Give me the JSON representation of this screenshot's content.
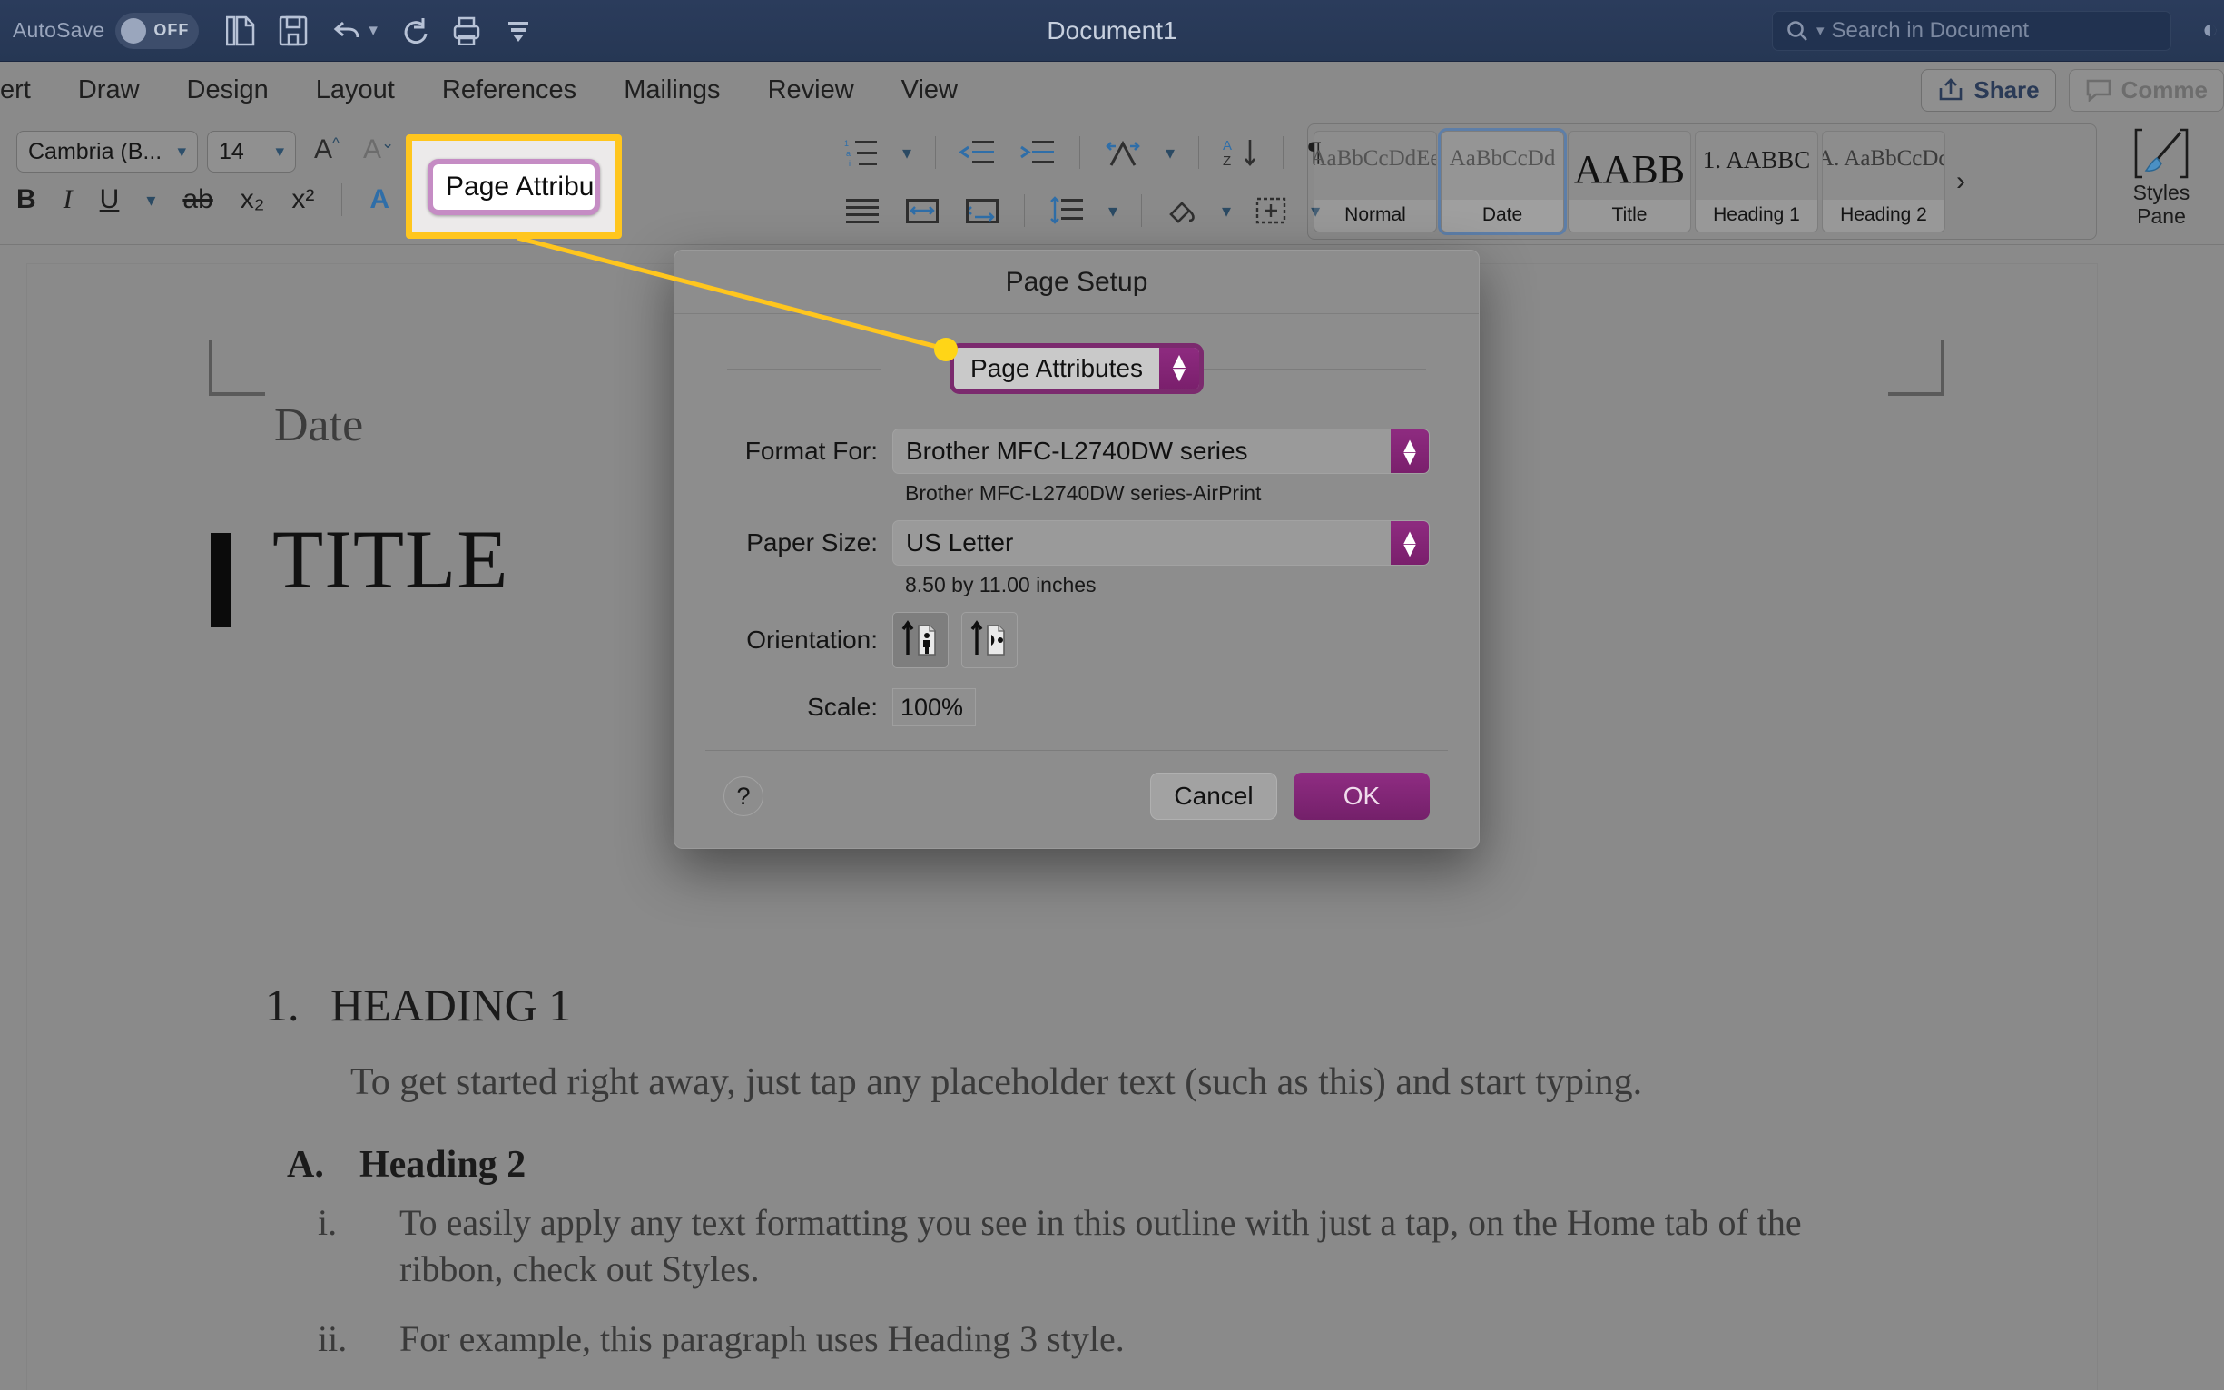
{
  "titlebar": {
    "autosave_label": "AutoSave",
    "autosave_state": "OFF",
    "document_title": "Document1",
    "search_placeholder": "Search in Document",
    "quick_access": [
      {
        "name": "new-from-template-icon",
        "label": "New"
      },
      {
        "name": "save-icon",
        "label": "Save"
      },
      {
        "name": "undo-icon",
        "label": "Undo"
      },
      {
        "name": "redo-icon",
        "label": "Redo"
      },
      {
        "name": "print-icon",
        "label": "Print"
      },
      {
        "name": "customize-toolbar-icon",
        "label": "Customize"
      }
    ]
  },
  "ribbon": {
    "tabs": [
      "ert",
      "Draw",
      "Design",
      "Layout",
      "References",
      "Mailings",
      "Review",
      "View"
    ],
    "share_label": "Share",
    "comments_label": "Comme",
    "font_name": "Cambria (B...",
    "font_size": "14",
    "grow_font": "A",
    "shrink_font": "A",
    "format_icons": [
      "B",
      "I",
      "U",
      "ab",
      "x₂",
      "x²",
      "A"
    ],
    "styles": [
      {
        "preview": "AaBbCcDdEe",
        "name": "Normal",
        "selected": false
      },
      {
        "preview": "AaBbCcDd",
        "name": "Date",
        "selected": true
      },
      {
        "preview": "AABB",
        "name": "Title",
        "selected": false
      },
      {
        "preview": "1.  AABBC",
        "name": "Heading 1",
        "selected": false
      },
      {
        "preview": "A. AaBbCcDd",
        "name": "Heading 2",
        "selected": false
      }
    ],
    "gallery_more": "›",
    "styles_pane_label_line1": "Styles",
    "styles_pane_label_line2": "Pane"
  },
  "callout": {
    "value": "Page Attributes",
    "highlight_color": "#FFC61E",
    "select_border_color": "#c58cc4",
    "stepper_color": "#b4309f"
  },
  "dialog": {
    "title": "Page Setup",
    "attributes_value": "Page Attributes",
    "format_for_label": "Format For:",
    "format_for_value": "Brother MFC-L2740DW series",
    "format_for_note": "Brother MFC-L2740DW series-AirPrint",
    "paper_size_label": "Paper Size:",
    "paper_size_value": "US Letter",
    "paper_size_note": "8.50 by 11.00 inches",
    "orientation_label": "Orientation:",
    "orientation_selected": "portrait",
    "scale_label": "Scale:",
    "scale_value": "100%",
    "help_label": "?",
    "cancel_label": "Cancel",
    "ok_label": "OK",
    "accent_color": "#7a1f6c"
  },
  "document": {
    "date": "Date",
    "title": "TITLE",
    "heading1_number": "1.",
    "heading1_text": "HEADING 1",
    "paragraph1": "To get started right away, just tap any placeholder text (such as this) and start typing.",
    "heading2_number": "A.",
    "heading2_text": "Heading 2",
    "list_items": [
      {
        "marker": "i.",
        "text": "To easily apply any text formatting you see in this outline with just a tap, on the Home tab of the ribbon, check out Styles."
      },
      {
        "marker": "ii.",
        "text": "For example, this paragraph uses Heading 3 style."
      }
    ]
  }
}
